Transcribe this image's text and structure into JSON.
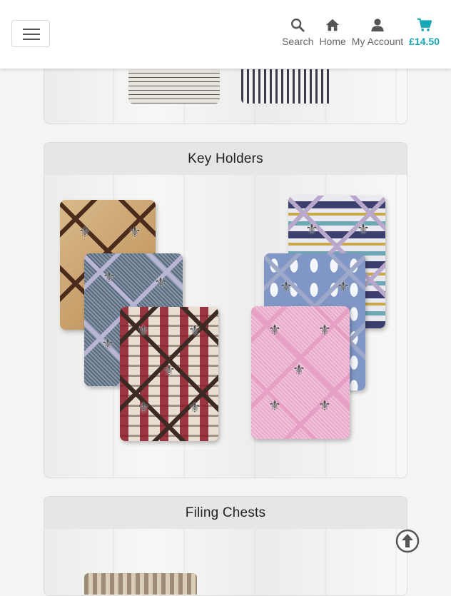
{
  "header": {
    "nav": {
      "search_label": "Search",
      "home_label": "Home",
      "account_label": "My Account",
      "cart_total": "£14.50"
    }
  },
  "categories": [
    {
      "title": ""
    },
    {
      "title": "Key Holders"
    },
    {
      "title": "Filing Chests"
    }
  ],
  "colors": {
    "accent": "#18a7b5",
    "header_bg": "#ffffff",
    "page_bg": "#f4f4f4",
    "card_header_bg": "#e6e6e6"
  },
  "icons": {
    "menu": "hamburger-icon",
    "search": "search-icon",
    "home": "home-icon",
    "account": "user-icon",
    "cart": "cart-icon",
    "back_to_top": "arrow-up-circle-icon"
  }
}
